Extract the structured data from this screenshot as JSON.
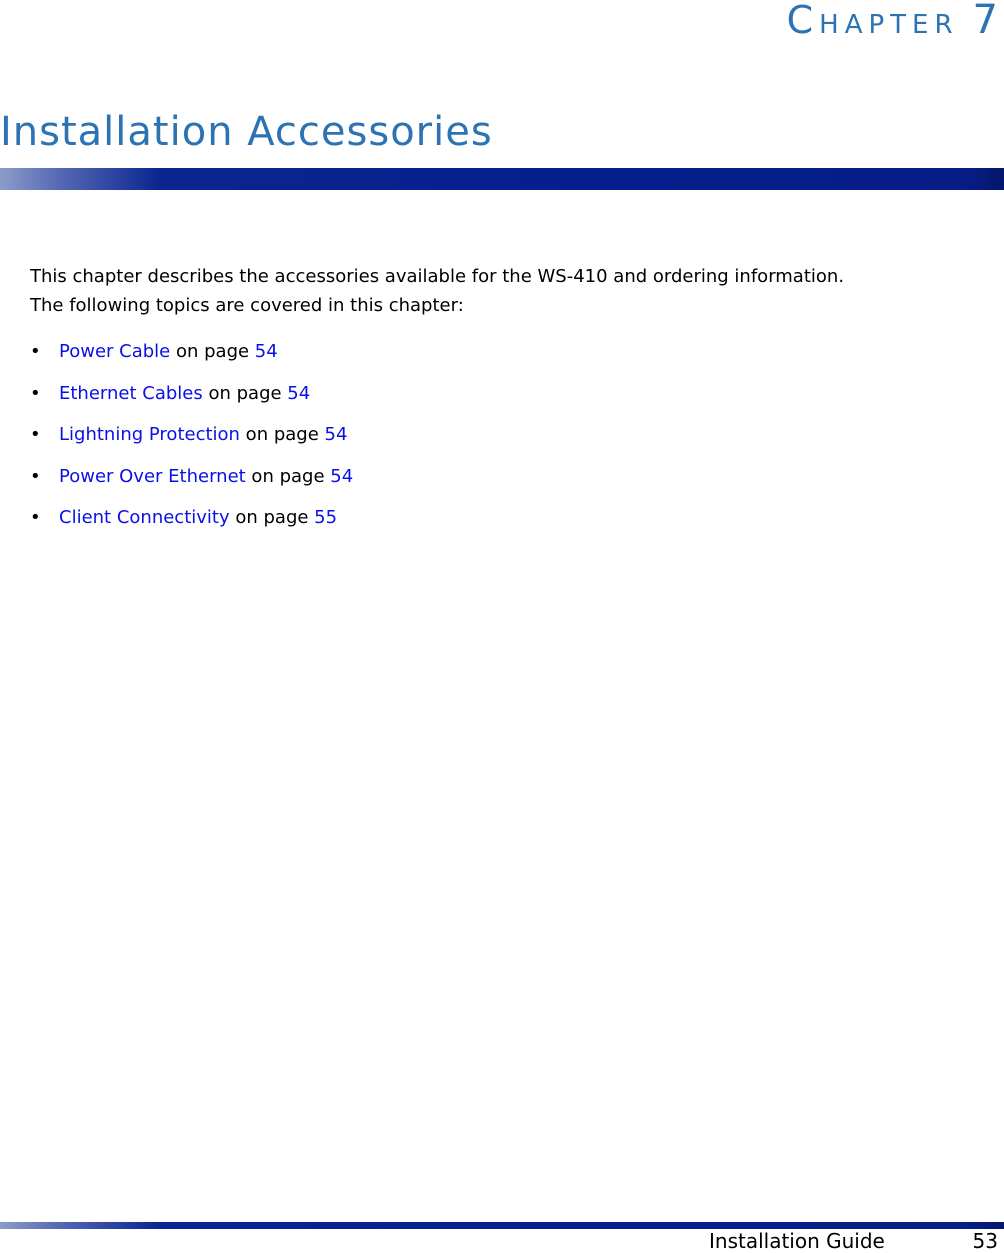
{
  "header": {
    "chapter_first_letter": "C",
    "chapter_rest": "HAPTER",
    "chapter_number": "7",
    "title": "Installation Accessories"
  },
  "intro": {
    "line1": "This chapter describes the accessories available for the WS-410 and ordering information.",
    "line2": "The following topics are covered in this chapter:"
  },
  "topics": [
    {
      "bullet": "•",
      "label": "Power Cable",
      "connector": " on page ",
      "page": "54"
    },
    {
      "bullet": "•",
      "label": "Ethernet Cables",
      "connector": " on page ",
      "page": "54"
    },
    {
      "bullet": "•",
      "label": "Lightning Protection",
      "connector": " on page ",
      "page": "54"
    },
    {
      "bullet": "•",
      "label": "Power Over Ethernet",
      "connector": " on page ",
      "page": "54"
    },
    {
      "bullet": "•",
      "label": "Client Connectivity",
      "connector": " on page ",
      "page": "55"
    }
  ],
  "footer": {
    "guide_name": "Installation Guide",
    "page_number": "53"
  },
  "colors": {
    "heading": "#2b73b3",
    "link": "#0a10e6",
    "bar": "#061e8c"
  }
}
